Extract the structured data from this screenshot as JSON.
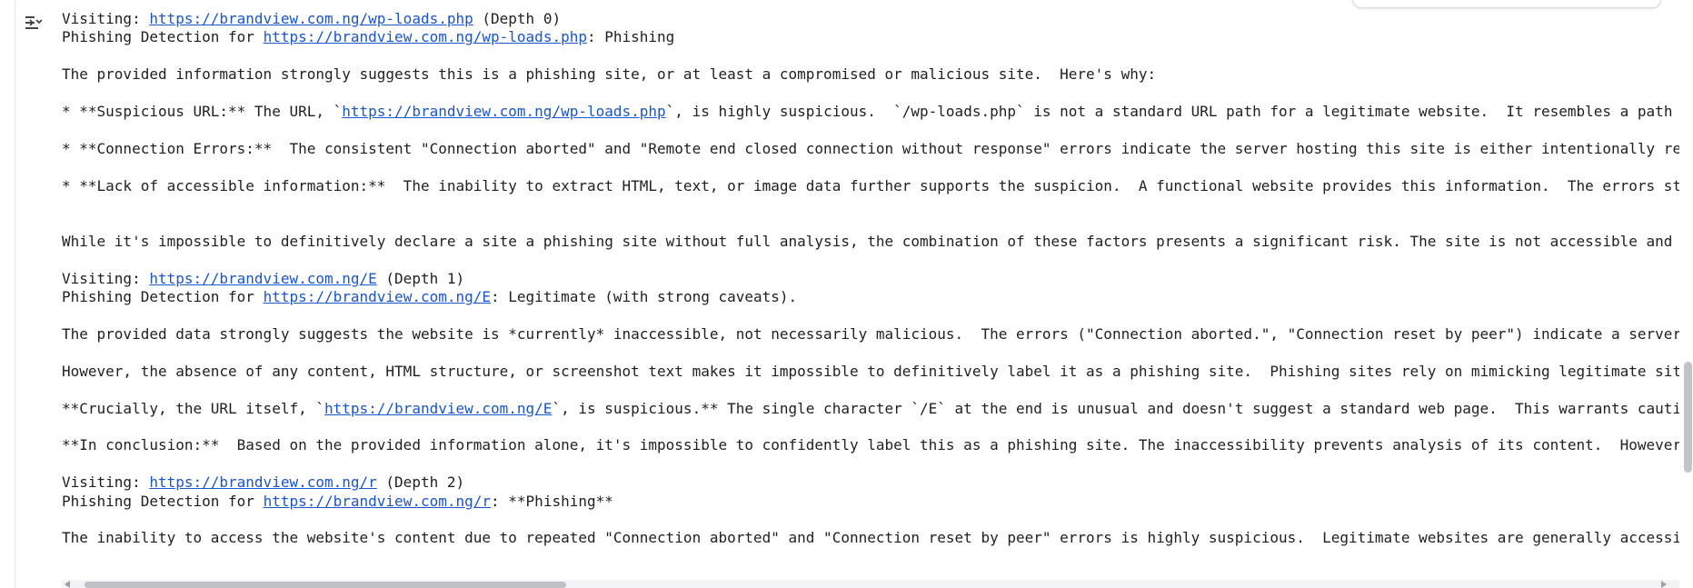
{
  "output": {
    "toggle_icon": "output-collapse-icon",
    "link_color": "#1a56c8",
    "text_color": "#202124",
    "blocks": [
      [
        {
          "t": "Visiting: "
        },
        {
          "t": "https://brandview.com.ng/wp-loads.php",
          "link": true
        },
        {
          "t": " (Depth 0)"
        }
      ],
      [
        {
          "t": "Phishing Detection for "
        },
        {
          "t": "https://brandview.com.ng/wp-loads.php",
          "link": true
        },
        {
          "t": ": Phishing"
        }
      ],
      [],
      [
        {
          "t": "The provided information strongly suggests this is a phishing site, or at least a compromised or malicious site.  Here's why:"
        }
      ],
      [],
      [
        {
          "t": "* **Suspicious URL:** The URL, `"
        },
        {
          "t": "https://brandview.com.ng/wp-loads.php",
          "link": true
        },
        {
          "t": "`, is highly suspicious.  `/wp-loads.php` is not a standard URL path for a legitimate website.  It resembles a path often used"
        }
      ],
      [],
      [
        {
          "t": "* **Connection Errors:**  The consistent \"Connection aborted\" and \"Remote end closed connection without response\" errors indicate the server hosting this site is either intentionally refusing conn"
        }
      ],
      [],
      [
        {
          "t": "* **Lack of accessible information:**  The inability to extract HTML, text, or image data further supports the suspicion.  A functional website provides this information.  The errors strongly sugg"
        }
      ],
      [],
      [],
      [
        {
          "t": "While it's impossible to definitively declare a site a phishing site without full analysis, the combination of these factors presents a significant risk. The site is not accessible and shows sever"
        }
      ],
      [],
      [
        {
          "t": "Visiting: "
        },
        {
          "t": "https://brandview.com.ng/E",
          "link": true
        },
        {
          "t": " (Depth 1)"
        }
      ],
      [
        {
          "t": "Phishing Detection for "
        },
        {
          "t": "https://brandview.com.ng/E",
          "link": true
        },
        {
          "t": ": Legitimate (with strong caveats)."
        }
      ],
      [],
      [
        {
          "t": "The provided data strongly suggests the website is *currently* inaccessible, not necessarily malicious.  The errors (\"Connection aborted.\", \"Connection reset by peer\") indicate a server-side probl"
        }
      ],
      [],
      [
        {
          "t": "However, the absence of any content, HTML structure, or screenshot text makes it impossible to definitively label it as a phishing site.  Phishing sites rely on mimicking legitimate sites to trick"
        }
      ],
      [],
      [
        {
          "t": "**Crucially, the URL itself, `"
        },
        {
          "t": "https://brandview.com.ng/E",
          "link": true
        },
        {
          "t": "`, is suspicious.** The single character `/E` at the end is unusual and doesn't suggest a standard web page.  This warrants caution.  One wo"
        }
      ],
      [],
      [
        {
          "t": "**In conclusion:**  Based on the provided information alone, it's impossible to confidently label this as a phishing site. The inaccessibility prevents analysis of its content.  However, the unusu"
        }
      ],
      [],
      [
        {
          "t": "Visiting: "
        },
        {
          "t": "https://brandview.com.ng/r",
          "link": true
        },
        {
          "t": " (Depth 2)"
        }
      ],
      [
        {
          "t": "Phishing Detection for "
        },
        {
          "t": "https://brandview.com.ng/r",
          "link": true
        },
        {
          "t": ": **Phishing**"
        }
      ],
      [],
      [
        {
          "t": "The inability to access the website's content due to repeated \"Connection aborted\" and \"Connection reset by peer\" errors is highly suspicious.  Legitimate websites are generally accessible. While"
        }
      ]
    ]
  }
}
